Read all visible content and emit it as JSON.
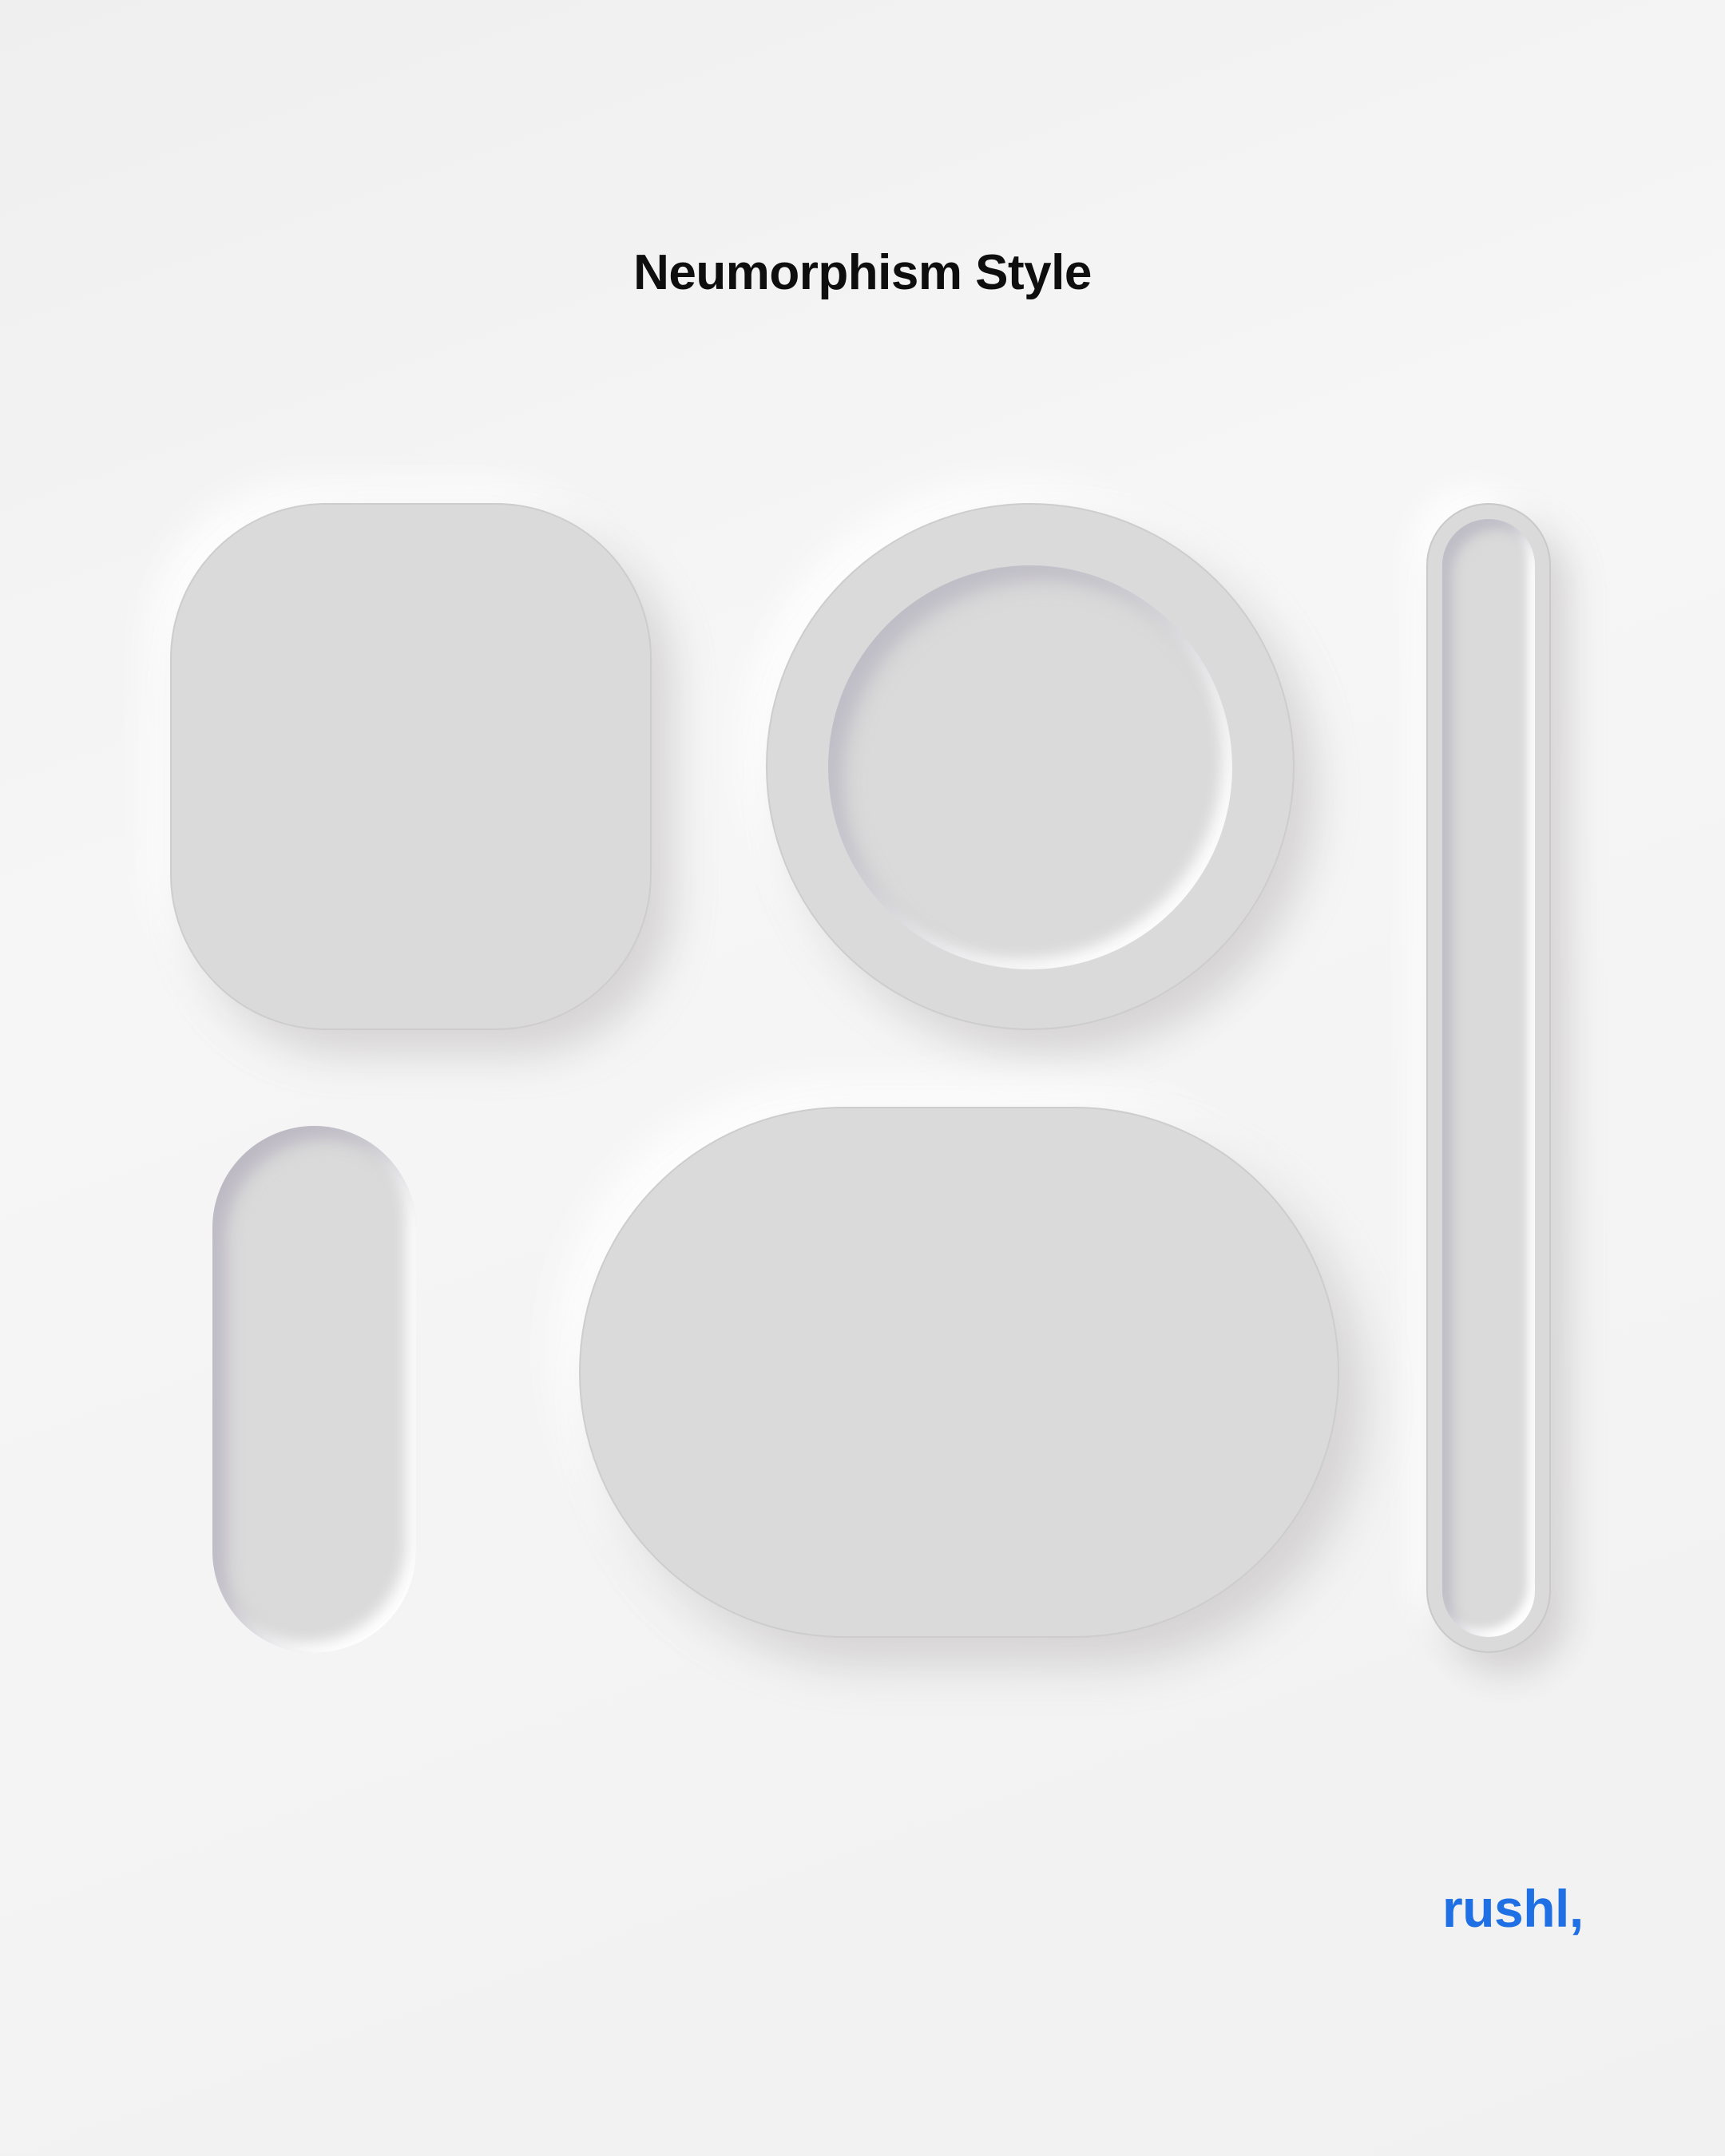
{
  "header": {
    "title": "Neumorphism Style"
  },
  "brand": {
    "signature": "rushl,",
    "accent_color": "#1f6fe5"
  },
  "palette": {
    "background": "#f3f3f3",
    "surface": "#dadada"
  }
}
